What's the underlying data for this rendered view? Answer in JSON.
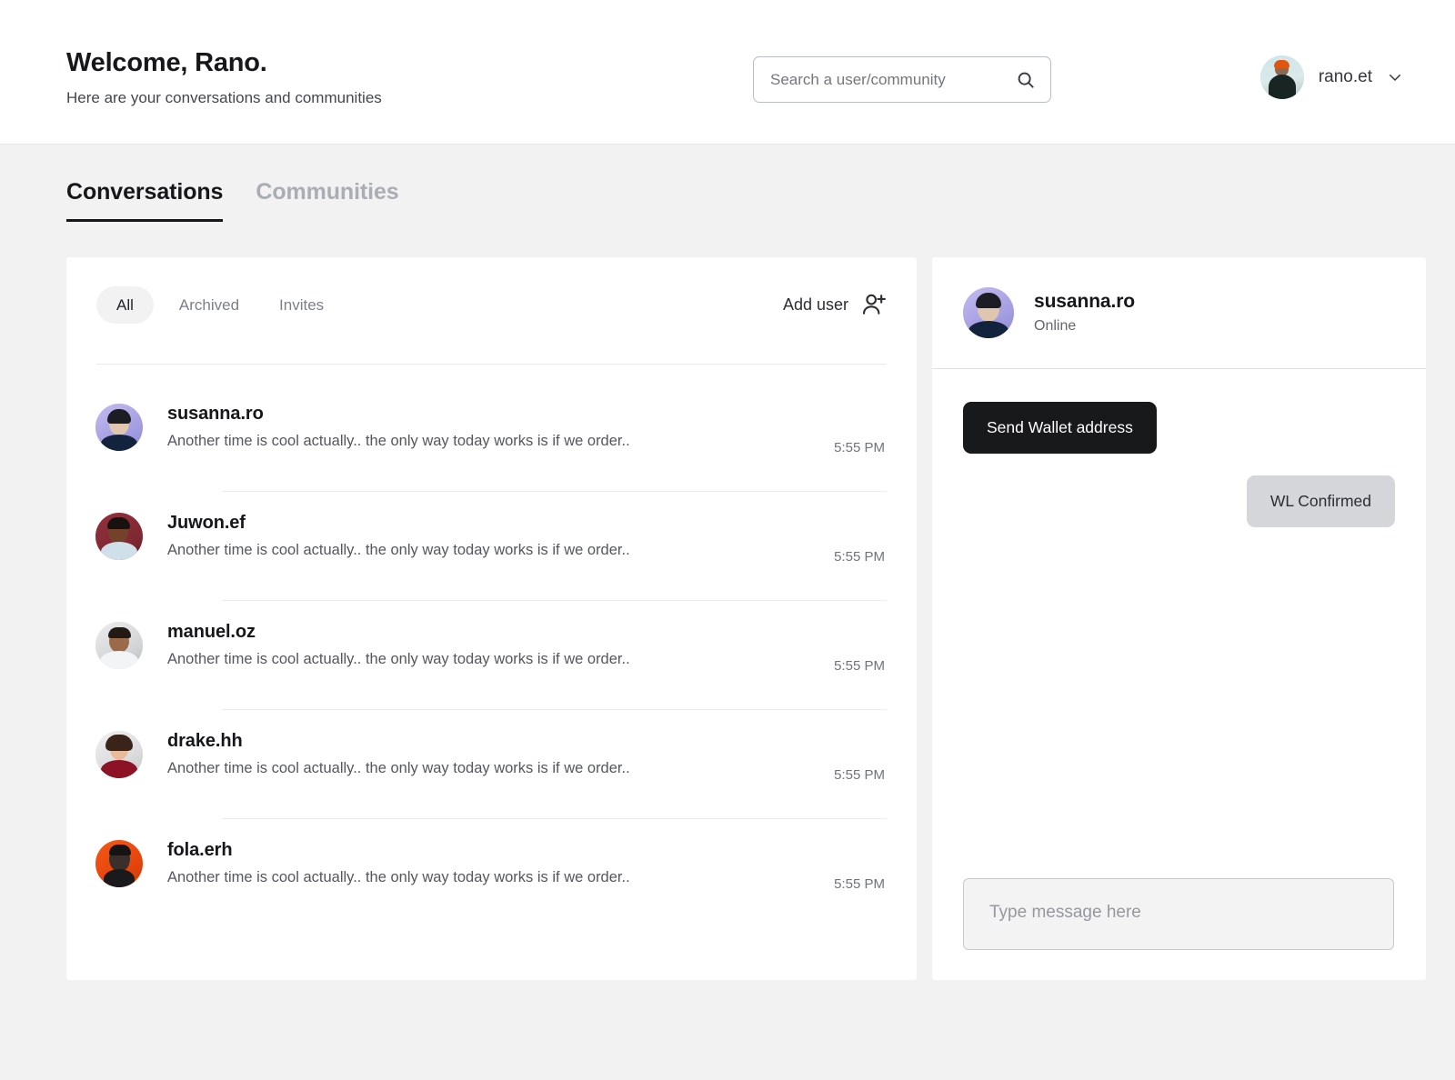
{
  "header": {
    "title": "Welcome, Rano.",
    "subtitle": "Here are your conversations and communities",
    "search": {
      "placeholder": "Search a user/community",
      "value": "",
      "icon": "search-icon"
    },
    "user": {
      "name": "rano.et",
      "chevron_icon": "chevron-down-icon",
      "avatar_icon": "avatar"
    }
  },
  "tabs": [
    {
      "label": "Conversations",
      "active": true
    },
    {
      "label": "Communities",
      "active": false
    }
  ],
  "list_panel": {
    "filters": [
      {
        "label": "All",
        "active": true
      },
      {
        "label": "Archived",
        "active": false
      },
      {
        "label": "Invites",
        "active": false
      }
    ],
    "add_user": {
      "label": "Add user",
      "icon": "add-user-icon"
    },
    "conversations": [
      {
        "name": "susanna.ro",
        "preview": "Another time is cool actually.. the only way today works is if we order..",
        "time": "5:55 PM",
        "avatar": {
          "bg": "#b0a8e8",
          "bg2": "#8f8ad8",
          "skin": "#e0c6ae",
          "hair": "#1c1c24",
          "shirt": "#13233d"
        }
      },
      {
        "name": "Juwon.ef",
        "preview": "Another time is cool actually.. the only way today works is if we order..",
        "time": "5:55 PM",
        "avatar": {
          "bg": "#7e2732",
          "bg2": "#9c3a45",
          "skin": "#74412a",
          "hair": "#17120f",
          "shirt": "#cfe0ea"
        }
      },
      {
        "name": "manuel.oz",
        "preview": "Another time is cool actually.. the only way today works is if we order..",
        "time": "5:55 PM",
        "avatar": {
          "bg": "#c9cacc",
          "bg2": "#e6e7e9",
          "skin": "#9a6a4a",
          "hair": "#241a15",
          "shirt": "#f3f4f5"
        }
      },
      {
        "name": "drake.hh",
        "preview": "Another time is cool actually.. the only way today works is if we order..",
        "time": "5:55 PM",
        "avatar": {
          "bg": "#d8d9da",
          "bg2": "#eceded",
          "skin": "#e8bb9a",
          "hair": "#3a2318",
          "shirt": "#8d1226"
        }
      },
      {
        "name": "fola.erh",
        "preview": "Another time is cool actually.. the only way today works is if we order..",
        "time": "5:55 PM",
        "avatar": {
          "bg": "#e8450d",
          "bg2": "#f25a16",
          "skin": "#3a2f2b",
          "hair": "#161412",
          "shirt": "#1a1a1c"
        }
      }
    ]
  },
  "chat_panel": {
    "peer": {
      "name": "susanna.ro",
      "status": "Online",
      "avatar": {
        "bg": "#b0a8e8",
        "bg2": "#8f8ad8",
        "skin": "#e0c6ae",
        "hair": "#1c1c24",
        "shirt": "#13233d"
      }
    },
    "messages": [
      {
        "text": "Send Wallet address",
        "direction": "incoming"
      },
      {
        "text": "WL Confirmed",
        "direction": "outgoing"
      }
    ],
    "composer": {
      "placeholder": "Type message here",
      "value": ""
    }
  },
  "colors": {
    "page_bg": "#f2f2f2",
    "card_bg": "#ffffff",
    "text_primary": "#15171a",
    "text_muted": "#7c8088",
    "bubble_incoming_bg": "#18191b",
    "bubble_outgoing_bg": "#d5d6d9"
  }
}
